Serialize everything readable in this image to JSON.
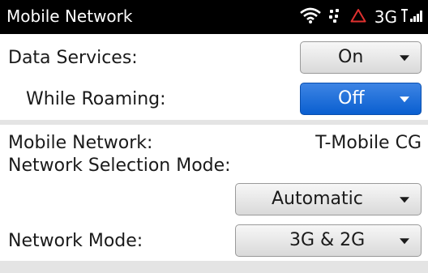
{
  "status_bar": {
    "title": "Mobile Network",
    "network_type": "3G",
    "icons": [
      "wifi-icon",
      "bbm-activity-icon",
      "alert-triangle-icon",
      "3g-text",
      "signal-bars-icon"
    ],
    "colors": {
      "background": "#000000",
      "text": "#ffffff",
      "alert": "#e0312f"
    }
  },
  "data_services": {
    "label": "Data Services:",
    "value": "On"
  },
  "while_roaming": {
    "label": "While Roaming:",
    "value": "Off"
  },
  "mobile_network": {
    "label": "Mobile Network:",
    "value": "T-Mobile CG"
  },
  "network_selection_mode": {
    "label": "Network Selection Mode:",
    "value": "Automatic"
  },
  "network_mode": {
    "label": "Network Mode:",
    "value": "3G & 2G"
  },
  "colors": {
    "accent": "#0a5fd0",
    "divider": "#e4e4e4",
    "dropdown_border": "#9a9a9a"
  }
}
